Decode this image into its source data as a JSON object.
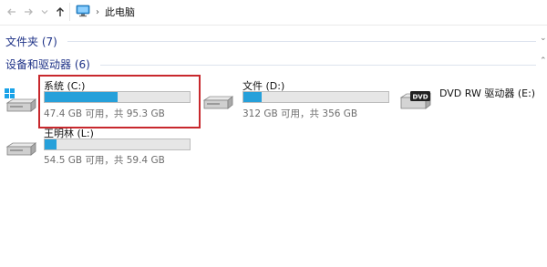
{
  "nav": {
    "back_icon": "arrow-left-icon",
    "forward_icon": "arrow-right-icon",
    "history_icon": "chevron-down-icon",
    "up_icon": "arrow-up-icon",
    "location_icon": "this-pc-icon",
    "separator": "›",
    "location": "此电脑"
  },
  "groups": {
    "folders": {
      "label": "文件夹 (7)"
    },
    "devices": {
      "label": "设备和驱动器 (6)"
    }
  },
  "drives": [
    {
      "name": "系统 (C:)",
      "info": "47.4 GB 可用，共 95.3 GB",
      "used_fraction": 0.503,
      "icon": "windows-system-drive-icon",
      "selected": true
    },
    {
      "name": "文件 (D:)",
      "info": "312 GB 可用，共 356 GB",
      "used_fraction": 0.124,
      "icon": "hard-drive-icon",
      "selected": false
    },
    {
      "name": "DVD RW 驱动器 (E:)",
      "icon": "dvd-drive-icon",
      "selected": false
    },
    {
      "name": "王明林 (L:)",
      "info": "54.5 GB 可用，共 59.4 GB",
      "used_fraction": 0.082,
      "icon": "hard-drive-icon",
      "selected": false
    }
  ],
  "colors": {
    "usage_bar": "#26a0da",
    "group_header": "#1e3287",
    "selection_outline": "#c8282d"
  }
}
